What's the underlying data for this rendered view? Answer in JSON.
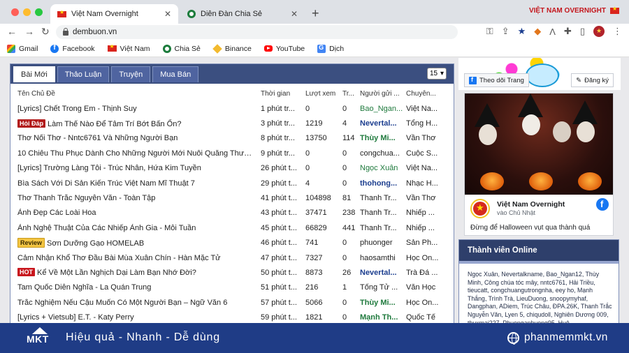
{
  "browser": {
    "tabs": [
      {
        "title": "Việt Nam Overnight",
        "active": true
      },
      {
        "title": "Diễn Đàn Chia Sẻ",
        "active": false
      }
    ],
    "brand_text": "VIỆT NAM",
    "brand_highlight": "OVERNIGHT",
    "url": "dembuon.vn",
    "bookmarks": [
      {
        "label": "Gmail",
        "icon": "gmail-icon"
      },
      {
        "label": "Facebook",
        "icon": "facebook-icon"
      },
      {
        "label": "Việt Nam",
        "icon": "vietnam-flag-icon"
      },
      {
        "label": "Chia Sẻ",
        "icon": "chiase-icon"
      },
      {
        "label": "Binance",
        "icon": "binance-icon"
      },
      {
        "label": "YouTube",
        "icon": "youtube-icon"
      },
      {
        "label": "Dịch",
        "icon": "translate-icon"
      }
    ]
  },
  "forum": {
    "tabs": [
      "Bài Mới",
      "Thảo Luận",
      "Truyện",
      "Mua Bán"
    ],
    "page_size": "15",
    "columns": [
      "Tên Chủ Đề",
      "Thời gian",
      "Lượt xem",
      "Tr...",
      "Người gửi ...",
      "Chuyên..."
    ],
    "rows": [
      {
        "prefix": "[Lyrics]",
        "badge": "",
        "title": "Chết Trong Em - Thịnh Suy",
        "time": "1 phút tr...",
        "views": "0",
        "replies": "0",
        "user": "Bao_Ngan...",
        "user_style": "green",
        "cat": "Việt Na..."
      },
      {
        "prefix": "",
        "badge": "Hỏi Đáp",
        "title": "Làm Thế Nào Để Tâm Trí Bớt Bấn Ổn?",
        "time": "3 phút tr...",
        "views": "1219",
        "replies": "4",
        "user": "Nevertal...",
        "user_style": "blue-bold",
        "cat": "Tổng H..."
      },
      {
        "prefix": "",
        "badge": "",
        "title": "Thơ Nối Thơ - Nntc6761 Và Những Người Bạn",
        "time": "8 phút tr...",
        "views": "13750",
        "replies": "114",
        "user": "Thùy Mi...",
        "user_style": "green-bold",
        "cat": "Vần Thơ"
      },
      {
        "prefix": "",
        "badge": "",
        "title": "10 Chiêu Thu Phục Dành Cho Những Người Mới Nuôi Quăng Thượ...",
        "time": "9 phút tr...",
        "views": "0",
        "replies": "0",
        "user": "congchua...",
        "user_style": "plain",
        "cat": "Cuộc S..."
      },
      {
        "prefix": "[Lyrics]",
        "badge": "",
        "title": "Trường Làng Tôi - Trúc Nhân, Hứa Kim Tuyền",
        "time": "26 phút t...",
        "views": "0",
        "replies": "0",
        "user": "Ngọc Xuân",
        "user_style": "green",
        "cat": "Việt Na..."
      },
      {
        "prefix": "",
        "badge": "",
        "title": "Bìa Sách Với Di Sản Kiến Trúc Việt Nam Mĩ Thuật 7",
        "time": "29 phút t...",
        "views": "4",
        "replies": "0",
        "user": "thohong...",
        "user_style": "blue-bold",
        "cat": "Nhạc H..."
      },
      {
        "prefix": "",
        "badge": "",
        "title": "Thơ Thanh Trắc Nguyễn Văn - Toàn Tập",
        "time": "41 phút t...",
        "views": "104898",
        "replies": "81",
        "user": "Thanh Tr...",
        "user_style": "plain",
        "cat": "Vần Thơ"
      },
      {
        "prefix": "",
        "badge": "",
        "title": "Ảnh Đẹp Các Loài Hoa",
        "time": "43 phút t...",
        "views": "37471",
        "replies": "238",
        "user": "Thanh Tr...",
        "user_style": "plain",
        "cat": "Nhiếp ..."
      },
      {
        "prefix": "",
        "badge": "",
        "title": "Ảnh Nghệ Thuật Của Các Nhiếp Ảnh Gia - Mỗi Tuần",
        "time": "45 phút t...",
        "views": "66829",
        "replies": "441",
        "user": "Thanh Tr...",
        "user_style": "plain",
        "cat": "Nhiếp ..."
      },
      {
        "prefix": "",
        "badge": "Review",
        "title": "Sơn Dưỡng Gạo HOMELAB",
        "time": "46 phút t...",
        "views": "741",
        "replies": "0",
        "user": "phuonger",
        "user_style": "plain",
        "cat": "Sản Ph..."
      },
      {
        "prefix": "",
        "badge": "",
        "title": "Cảm Nhận Khổ Thơ Đầu Bài Mùa Xuân Chín - Hàn Mặc Tử",
        "time": "47 phút t...",
        "views": "7327",
        "replies": "0",
        "user": "haosamthi",
        "user_style": "plain",
        "cat": "Học On..."
      },
      {
        "prefix": "",
        "badge": "HOT",
        "title": "Kể Về Một Lần Nghịch Dại Làm Bạn Nhớ Đời?",
        "time": "50 phút t...",
        "views": "8873",
        "replies": "26",
        "user": "Nevertal...",
        "user_style": "blue-bold",
        "cat": "Trà Đá ..."
      },
      {
        "prefix": "",
        "badge": "",
        "title": "Tam Quốc Diễn Nghĩa - La Quán Trung",
        "time": "51 phút t...",
        "views": "216",
        "replies": "1",
        "user": "Tống Tử ...",
        "user_style": "plain",
        "cat": "Văn Học"
      },
      {
        "prefix": "",
        "badge": "",
        "title": "Trắc Nghiệm Nếu Cậu Muốn Có Một Người Bạn – Ngữ Văn 6",
        "time": "57 phút t...",
        "views": "5066",
        "replies": "0",
        "user": "Thùy Mi...",
        "user_style": "green-bold",
        "cat": "Học On..."
      },
      {
        "prefix": "[Lyrics + Vietsub]",
        "badge": "",
        "title": "E.T. - Katy Perry",
        "time": "59 phút t...",
        "views": "1821",
        "replies": "0",
        "user": "Mạnh Th...",
        "user_style": "green-bold",
        "cat": "Quốc Tế"
      }
    ]
  },
  "sidebar": {
    "follow_label": "Theo dõi Trang",
    "signup_label": "Đăng ký",
    "fb_page_name": "Việt Nam Overnight",
    "fb_page_sub": "vào Chủ Nhật",
    "fb_post_text": "Đừng để Halloween vụt qua thành quá",
    "online_title": "Thành viên Online",
    "online_members": "Ngọc Xuân, Nevertalkname, Bao_Ngan12, Thùy Minh, Công chúa tóc mây, nntc6761, Hải Triều, tieucatt, congchuangutrongnha, eey ho, Mạnh Thắng, Trình Trà, LieuDuong, snoopymyhaf, Dangphan, ADiem, Trúc Châu, ĐPA.26K, Thanh Trắc Nguyễn Văn, Lyen 5, chiqudoll, Nghiên Dương 009, thuxmai227, Phuonganhuong95, Huê"
  },
  "banner": {
    "logo_text": "MKT",
    "slogan": "Hiệu quả - Nhanh - Dễ dùng",
    "website": "phanmemmkt.vn"
  }
}
